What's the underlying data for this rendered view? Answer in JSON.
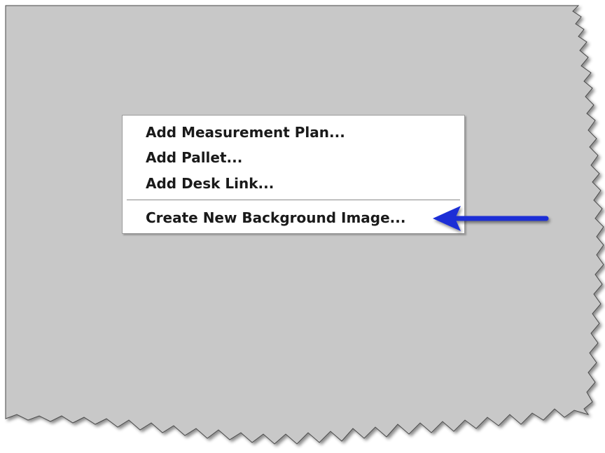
{
  "context_menu": {
    "items": [
      {
        "label": "Add Measurement Plan..."
      },
      {
        "label": "Add Pallet..."
      },
      {
        "label": "Add Desk Link..."
      },
      {
        "label": "Create New Background Image..."
      }
    ]
  },
  "colors": {
    "canvas": "#c8c8c8",
    "arrow": "#1a2fd6",
    "menu_background": "#ffffff"
  },
  "annotation": {
    "type": "arrow",
    "points_to": "Create New Background Image..."
  }
}
